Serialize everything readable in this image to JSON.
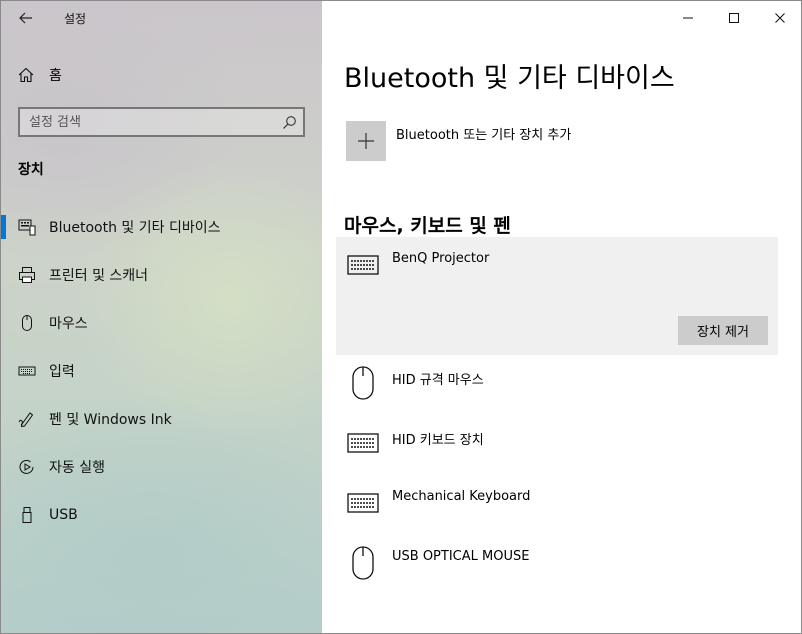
{
  "window": {
    "title": "설정"
  },
  "sidebar": {
    "home_label": "홈",
    "search_placeholder": "설정 검색",
    "section_title": "장치",
    "items": [
      {
        "label": "Bluetooth 및 기타 디바이스",
        "icon": "bluetooth-devices-icon",
        "selected": true
      },
      {
        "label": "프린터 및 스캐너",
        "icon": "printer-icon"
      },
      {
        "label": "마우스",
        "icon": "mouse-icon"
      },
      {
        "label": "입력",
        "icon": "keyboard-icon"
      },
      {
        "label": "펜 및 Windows Ink",
        "icon": "pen-icon"
      },
      {
        "label": "자동 실행",
        "icon": "autoplay-icon"
      },
      {
        "label": "USB",
        "icon": "usb-icon"
      }
    ]
  },
  "main": {
    "title": "Bluetooth 및 기타 디바이스",
    "add_label": "Bluetooth 또는 기타 장치 추가",
    "subheading": "마우스, 키보드 및 펜",
    "remove_label": "장치 제거",
    "devices": [
      {
        "name": "BenQ Projector",
        "icon": "keyboard-icon",
        "selected": true
      },
      {
        "name": "HID 규격 마우스",
        "icon": "mouse-icon"
      },
      {
        "name": "HID 키보드 장치",
        "icon": "keyboard-icon"
      },
      {
        "name": "Mechanical Keyboard",
        "icon": "keyboard-icon"
      },
      {
        "name": "USB OPTICAL MOUSE",
        "icon": "mouse-icon"
      }
    ]
  },
  "colors": {
    "accent": "#0078d7",
    "tile": "#cccccc",
    "selected_bg": "#f0f0f0"
  }
}
